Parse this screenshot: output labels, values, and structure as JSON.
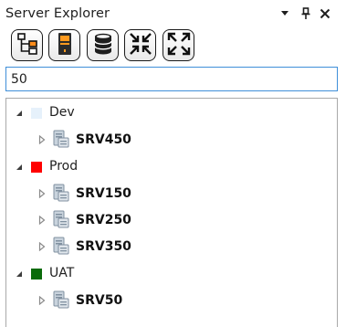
{
  "window": {
    "title": "Server Explorer"
  },
  "titlebar_buttons": [
    "dropdown-icon",
    "pin-icon",
    "close-icon"
  ],
  "toolbar": {
    "buttons": [
      {
        "name": "connect-hierarchy-button",
        "icon": "hierarchy-icon"
      },
      {
        "name": "server-button",
        "icon": "server-tower-icon"
      },
      {
        "name": "database-button",
        "icon": "database-icon"
      },
      {
        "name": "collapse-all-button",
        "icon": "collapse-arrows-icon"
      },
      {
        "name": "expand-all-button",
        "icon": "expand-arrows-icon"
      }
    ]
  },
  "search": {
    "value": "50",
    "placeholder": ""
  },
  "tree": {
    "environments": [
      {
        "label": "Dev",
        "color": "#e6f1fb",
        "expanded": true,
        "servers": [
          {
            "label": "SRV450",
            "expanded": false
          }
        ]
      },
      {
        "label": "Prod",
        "color": "#ff0000",
        "expanded": true,
        "servers": [
          {
            "label": "SRV150",
            "expanded": false
          },
          {
            "label": "SRV250",
            "expanded": false
          },
          {
            "label": "SRV350",
            "expanded": false
          }
        ]
      },
      {
        "label": "UAT",
        "color": "#0a6b0a",
        "expanded": true,
        "servers": [
          {
            "label": "SRV50",
            "expanded": false
          }
        ]
      }
    ]
  },
  "colors": {
    "accent_border": "#3f8fd9",
    "tree_border": "#a9a9a9"
  }
}
